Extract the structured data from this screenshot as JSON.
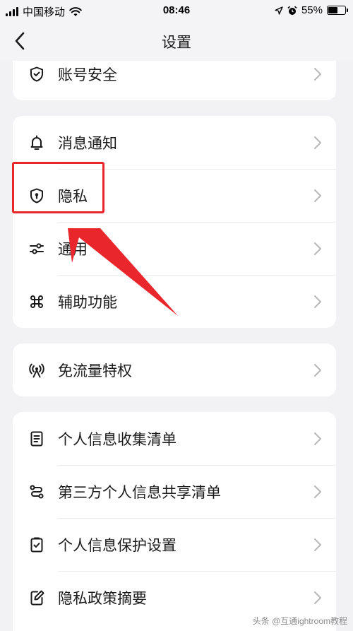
{
  "status_bar": {
    "carrier": "中国移动",
    "time": "08:46",
    "battery": "55%",
    "battery_level": 0.55
  },
  "nav": {
    "title": "设置"
  },
  "groups": [
    {
      "items": [
        {
          "label": "账号安全",
          "icon": "shield-check-icon"
        }
      ]
    },
    {
      "items": [
        {
          "label": "消息通知",
          "icon": "bell-icon"
        },
        {
          "label": "隐私",
          "icon": "privacy-shield-icon"
        },
        {
          "label": "通用",
          "icon": "sliders-icon"
        },
        {
          "label": "辅助功能",
          "icon": "command-icon"
        }
      ]
    },
    {
      "items": [
        {
          "label": "免流量特权",
          "icon": "signal-tower-icon"
        }
      ]
    },
    {
      "items": [
        {
          "label": "个人信息收集清单",
          "icon": "document-list-icon"
        },
        {
          "label": "第三方个人信息共享清单",
          "icon": "share-flow-icon"
        },
        {
          "label": "个人信息保护设置",
          "icon": "checklist-icon"
        },
        {
          "label": "隐私政策摘要",
          "icon": "edit-document-icon"
        }
      ]
    }
  ],
  "colors": {
    "annotation": "#e8262b",
    "background": "#f2f2f4"
  },
  "watermark": "头条 @互通ightroom教程"
}
